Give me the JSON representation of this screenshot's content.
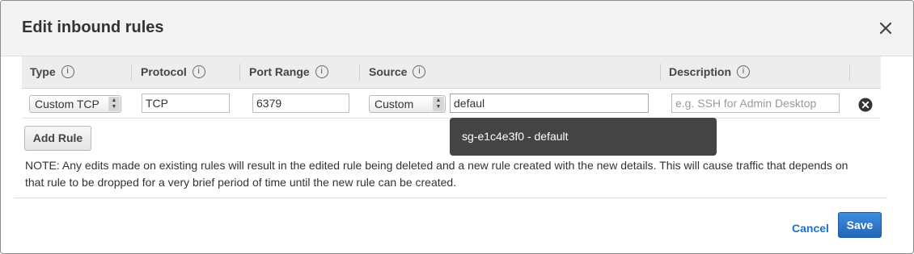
{
  "dialog": {
    "title": "Edit inbound rules",
    "close_icon": "close-icon"
  },
  "table": {
    "columns": [
      {
        "label": "Type",
        "info": "i"
      },
      {
        "label": "Protocol",
        "info": "i"
      },
      {
        "label": "Port Range",
        "info": "i"
      },
      {
        "label": "Source",
        "info": "i"
      },
      {
        "label": "Description",
        "info": "i"
      }
    ],
    "row": {
      "type": "Custom TCP",
      "protocol": "TCP",
      "port_range": "6379",
      "source_type": "Custom",
      "source_value": "defaul",
      "description_placeholder": "e.g. SSH for Admin Desktop",
      "remove_icon": "remove-icon"
    }
  },
  "autocomplete": {
    "suggestion": "sg-e1c4e3f0 - default"
  },
  "add_rule_label": "Add Rule",
  "note": "NOTE: Any edits made on existing rules will result in the edited rule being deleted and a new rule created with the new details. This will cause traffic that depends on that rule to be dropped for a very brief period of time until the new rule can be created.",
  "footer": {
    "cancel_label": "Cancel",
    "save_label": "Save"
  },
  "colors": {
    "primary": "#2a72c4",
    "link": "#1a73c7",
    "tooltip_bg": "#444444"
  }
}
